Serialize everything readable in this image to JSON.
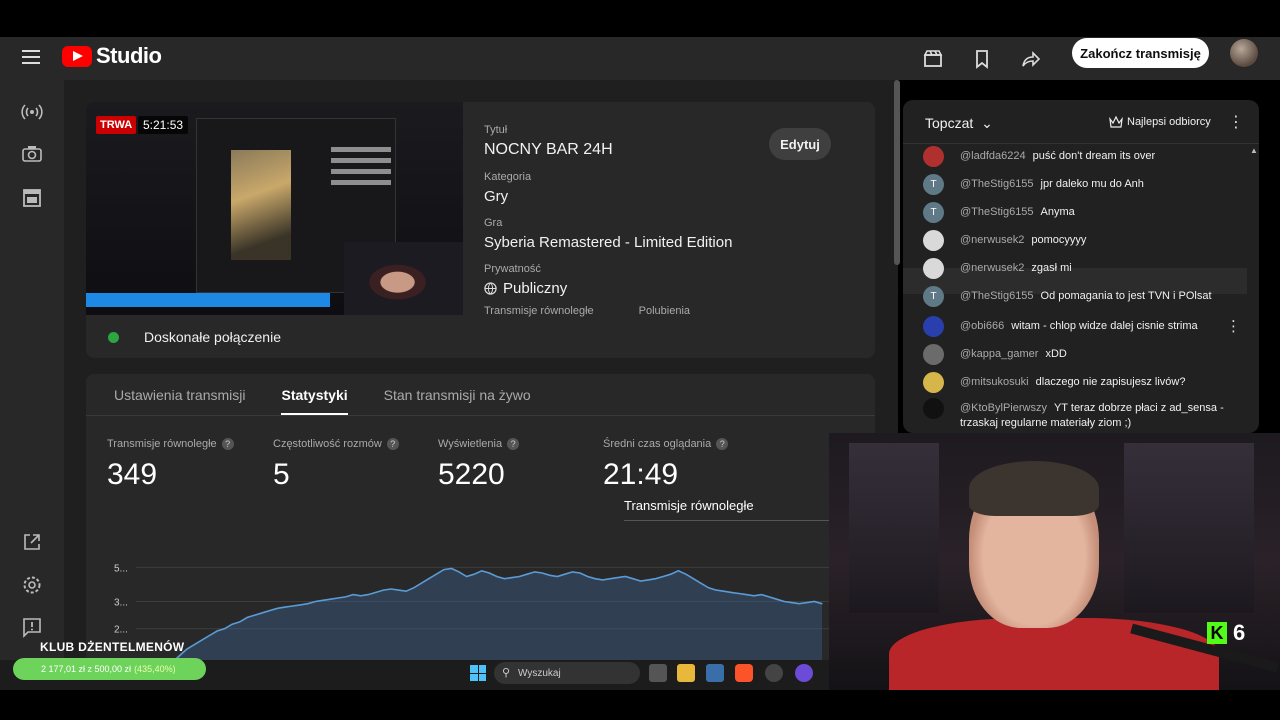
{
  "header": {
    "brand": "Studio",
    "end_stream_label": "Zakończ transmisję",
    "icons": [
      "menu-icon",
      "clapperboard-icon",
      "bookmark-icon",
      "share-icon"
    ]
  },
  "leftnav": {
    "icons": [
      "live-broadcast-icon",
      "camera-icon",
      "calendar-icon",
      "external-link-icon",
      "settings-icon",
      "feedback-icon"
    ]
  },
  "stream": {
    "live_badge": "TRWA",
    "duration": "5:21:53",
    "title_label": "Tytuł",
    "title": "NOCNY BAR 24H",
    "category_label": "Kategoria",
    "category": "Gry",
    "game_label": "Gra",
    "game": "Syberia Remastered - Limited Edition",
    "privacy_label": "Prywatność",
    "privacy": "Publiczny",
    "concurrent_label": "Transmisje równoległe",
    "likes_label": "Polubienia",
    "edit_label": "Edytuj",
    "connection": "Doskonałe połączenie",
    "connection_color": "#2ba640"
  },
  "tabs": [
    {
      "label": "Ustawienia transmisji",
      "active": false
    },
    {
      "label": "Statystyki",
      "active": true
    },
    {
      "label": "Stan transmisji na żywo",
      "active": false
    }
  ],
  "stats": [
    {
      "label": "Transmisje równoległe",
      "value": "349"
    },
    {
      "label": "Częstotliwość rozmów",
      "value": "5"
    },
    {
      "label": "Wyświetlenia",
      "value": "5220"
    },
    {
      "label": "Średni czas oglądania",
      "value": "21:49"
    }
  ],
  "chart_data": {
    "type": "area",
    "title": "Transmisje równoległe",
    "ytick_labels": [
      "5...",
      "3...",
      "2..."
    ],
    "values": [
      0.2,
      0.3,
      0.5,
      0.8,
      1.1,
      1.4,
      1.6,
      1.8,
      2.0,
      2.2,
      2.3,
      2.5,
      2.6,
      2.8,
      2.9,
      3.0,
      3.1,
      3.2,
      3.25,
      3.3,
      3.35,
      3.4,
      3.5,
      3.55,
      3.6,
      3.65,
      3.7,
      3.8,
      3.75,
      3.8,
      3.9,
      4.0,
      4.05,
      4.0,
      3.95,
      4.1,
      4.3,
      4.5,
      4.7,
      4.9,
      4.95,
      4.8,
      4.6,
      4.7,
      4.85,
      4.75,
      4.6,
      4.5,
      4.55,
      4.6,
      4.7,
      4.8,
      4.75,
      4.65,
      4.6,
      4.7,
      4.8,
      4.75,
      4.6,
      4.5,
      4.45,
      4.5,
      4.55,
      4.6,
      4.5,
      4.4,
      4.45,
      4.5,
      4.6,
      4.7,
      4.85,
      4.7,
      4.5,
      4.3,
      4.1,
      4.0,
      3.95,
      3.9,
      3.85,
      3.8,
      3.75,
      3.8,
      3.7,
      3.6,
      3.5,
      3.45,
      3.4,
      3.45,
      3.5,
      3.4
    ],
    "ylim": [
      0,
      5.5
    ],
    "grid": true
  },
  "chat": {
    "title": "Topczat",
    "top_viewers_label": "Najlepsi odbiorcy",
    "messages": [
      {
        "author": "@ladfda6224",
        "text": "puść don't dream its over",
        "avatar_color": "#b03030",
        "initial": ""
      },
      {
        "author": "@TheStig6155",
        "text": "jpr daleko mu do Anh",
        "avatar_color": "#5f7a86",
        "initial": "T"
      },
      {
        "author": "@TheStig6155",
        "text": "Anyma",
        "avatar_color": "#5f7a86",
        "initial": "T"
      },
      {
        "author": "@nerwusek2",
        "text": "pomocyyyy",
        "avatar_color": "#d9d9d9",
        "initial": ""
      },
      {
        "author": "@nerwusek2",
        "text": "zgasł mi",
        "avatar_color": "#d9d9d9",
        "initial": ""
      },
      {
        "author": "@TheStig6155",
        "text": "Od pomagania to jest TVN i POlsat",
        "avatar_color": "#5f7a86",
        "initial": "T"
      },
      {
        "author": "@obi666",
        "text": "witam - chlop widze dalej cisnie strima",
        "avatar_color": "#2a3fae",
        "initial": ""
      },
      {
        "author": "@kappa_gamer",
        "text": "xDD",
        "avatar_color": "#6b6b6b",
        "initial": ""
      },
      {
        "author": "@mitsukosuki",
        "text": "dlaczego nie zapisujesz livów?",
        "avatar_color": "#d6b64a",
        "initial": ""
      },
      {
        "author": "@KtoBylPierwszy",
        "text": "YT teraz dobrze płaci z ad_sensa - trzaskaj regularne materiały ziom ;)",
        "avatar_color": "#111111",
        "initial": ""
      }
    ]
  },
  "overlay": {
    "club_title": "KLUB DŻENTELMENÓW",
    "club_progress": "2 177,01 zł  z  500,00 zł",
    "club_percent": "(435,40%)",
    "kick_count": "6",
    "taskbar_search": "Wyszukaj"
  }
}
